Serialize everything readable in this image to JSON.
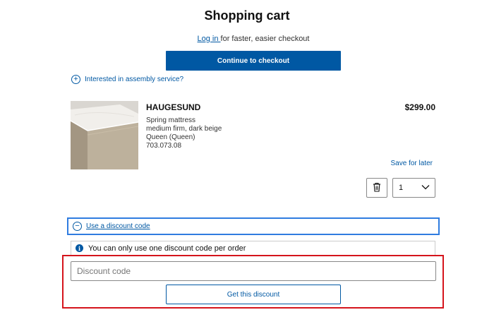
{
  "header": {
    "title": "Shopping cart"
  },
  "login": {
    "link_text": "Log in ",
    "rest_text": "for faster, easier checkout"
  },
  "checkout": {
    "button_label": "Continue to checkout"
  },
  "assembly": {
    "label": "Interested in assembly service?",
    "icon": "plus-circle-icon"
  },
  "product": {
    "name": "HAUGESUND",
    "description_lines": [
      "Spring mattress",
      "medium firm, dark beige",
      "Queen (Queen)",
      "703.073.08"
    ],
    "price": "$299.00",
    "save_for_later": "Save for later",
    "quantity": "1",
    "image": "mattress-image"
  },
  "discount": {
    "toggle_label": "Use a discount code",
    "toggle_icon": "minus-circle-icon",
    "info_text": "You can only use one discount code per order",
    "input_placeholder": "Discount code",
    "input_value": "",
    "apply_button_label": "Get this discount"
  },
  "colors": {
    "accent": "#0058a3",
    "highlight_blue": "#2f7ce0",
    "highlight_red": "#d5141c"
  }
}
